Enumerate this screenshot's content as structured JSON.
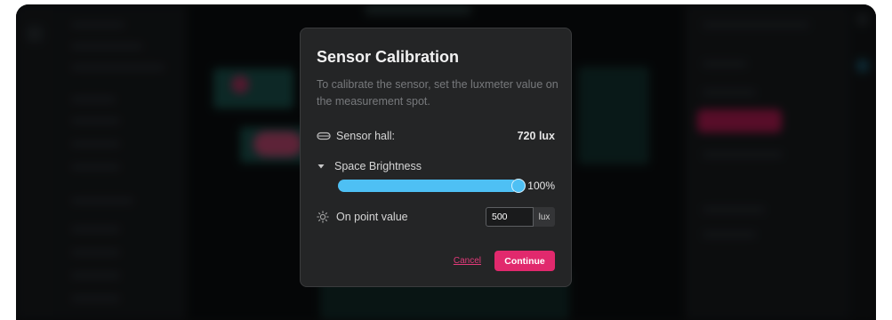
{
  "dialog": {
    "title": "Sensor Calibration",
    "description": "To calibrate the sensor, set the luxmeter value on the measurement spot.",
    "sensor_hall": {
      "label": "Sensor hall:",
      "value": "720 lux",
      "icon": "sensor-icon"
    },
    "space_brightness": {
      "label": "Space Brightness",
      "icon": "triangle-down-icon",
      "level": 1.0,
      "percent_label": "100%"
    },
    "on_point": {
      "label": "On point value",
      "icon": "brightness-icon",
      "input_value": "500",
      "unit": "lux"
    },
    "cancel_label": "Cancel",
    "continue_label": "Continue"
  },
  "colors": {
    "accent": "#e1296d",
    "slider": "#4ec0f4",
    "dialog_bg": "#242526"
  }
}
